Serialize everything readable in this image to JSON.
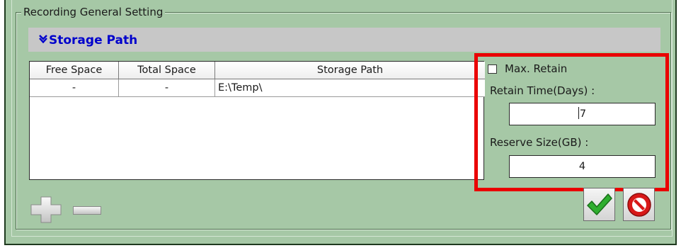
{
  "group": {
    "title": "Recording General Setting"
  },
  "section": {
    "icon": "double-chevron-down-icon",
    "title": "Storage Path"
  },
  "table": {
    "columns": [
      "Free Space",
      "Total Space",
      "Storage Path"
    ],
    "rows": [
      {
        "free_space": "-",
        "total_space": "-",
        "storage_path": "E:\\Temp\\"
      }
    ]
  },
  "retention": {
    "max_retain_label": "Max. Retain",
    "max_retain_checked": false,
    "retain_time_label": "Retain Time(Days) :",
    "retain_time_value": "7",
    "reserve_size_label": "Reserve Size(GB) :",
    "reserve_size_value": "4"
  },
  "actions": {
    "add_icon": "plus-icon",
    "remove_icon": "minus-icon",
    "ok_icon": "checkmark-icon",
    "cancel_icon": "no-entry-icon"
  },
  "colors": {
    "panel_background": "#a6c8a6",
    "section_bar": "#c7c7c7",
    "section_title": "#0000cc",
    "highlight_border": "#ea0000",
    "ok_green": "#2fae2f",
    "cancel_red": "#d81818"
  }
}
